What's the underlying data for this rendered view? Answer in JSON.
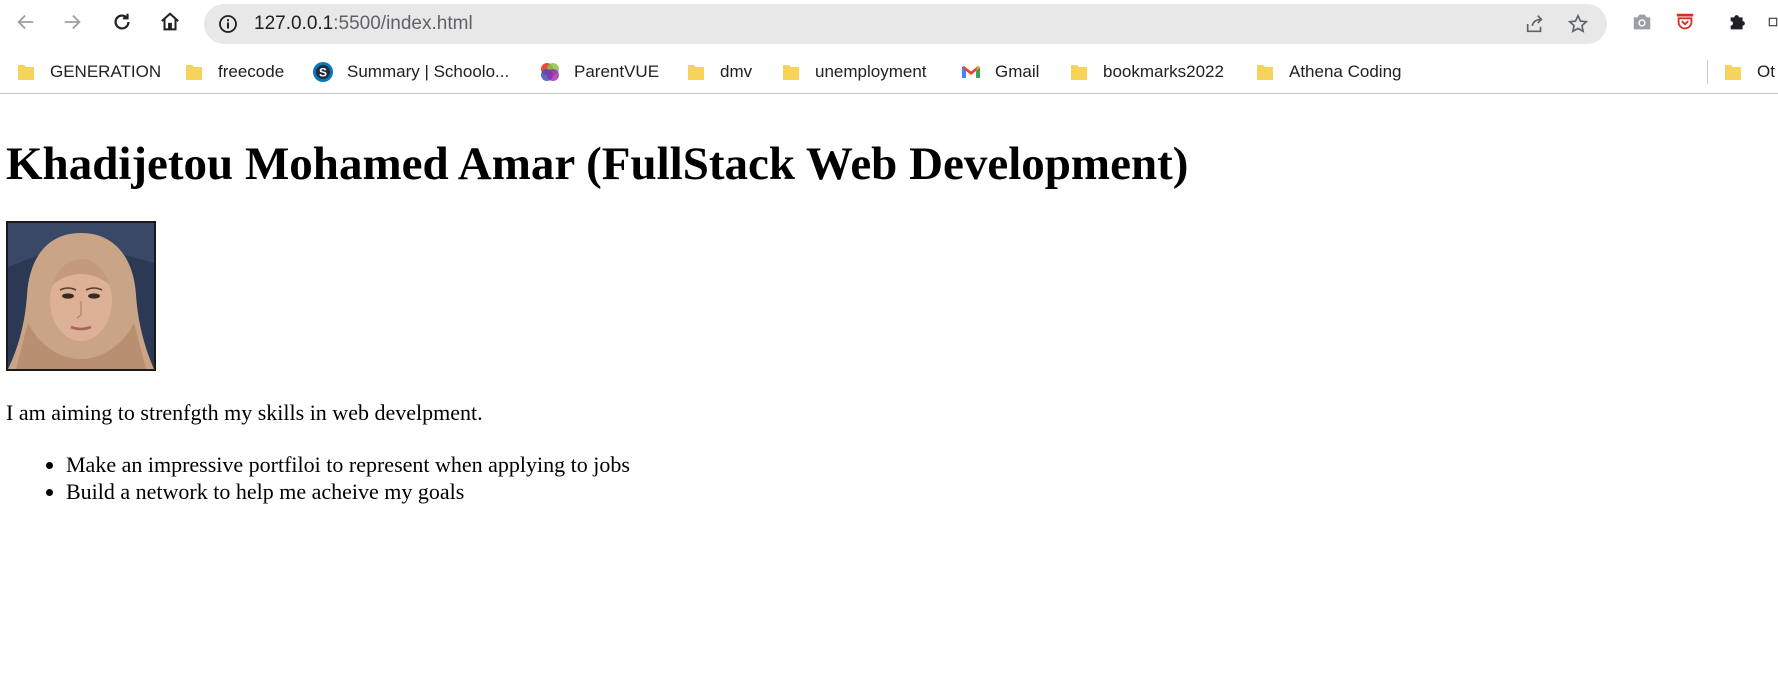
{
  "browser": {
    "url_host": "127.0.0.1",
    "url_rest": ":5500/index.html",
    "bookmarks": [
      {
        "label": "GENERATION",
        "icon": "folder-icon"
      },
      {
        "label": "freecode",
        "icon": "folder-icon"
      },
      {
        "label": "Summary | Schoolo...",
        "icon": "schoology-icon"
      },
      {
        "label": "ParentVUE",
        "icon": "parentvue-icon"
      },
      {
        "label": "dmv",
        "icon": "folder-icon"
      },
      {
        "label": "unemployment",
        "icon": "folder-icon"
      },
      {
        "label": "Gmail",
        "icon": "gmail-icon"
      },
      {
        "label": "bookmarks2022",
        "icon": "folder-icon"
      },
      {
        "label": "Athena Coding",
        "icon": "folder-icon"
      }
    ],
    "other_bookmarks_label": "Ot",
    "colors": {
      "folder": "#f6d35a",
      "accent_red": "#d93025"
    }
  },
  "page": {
    "title": "Khadijetou Mohamed Amar (FullStack Web Development)",
    "intro": "I am aiming to strenfgth my skills in web develpment.",
    "goals": [
      "Make an impressive portfiloi to represent when applying to jobs",
      "Build a network to help me acheive my goals"
    ]
  }
}
